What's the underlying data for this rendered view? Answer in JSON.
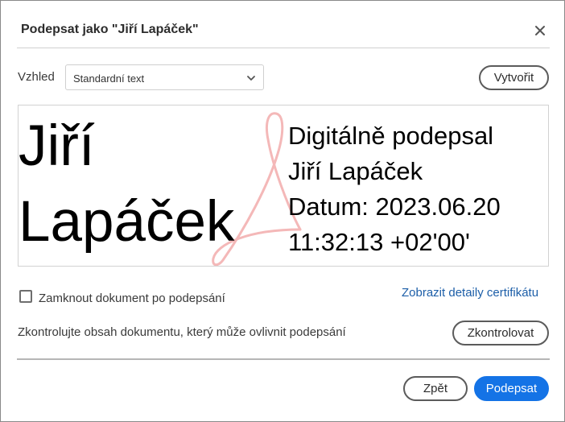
{
  "dialog": {
    "title": "Podepsat jako \"Jiří Lapáček\"",
    "close_icon": "close-icon"
  },
  "appearance": {
    "label": "Vzhled",
    "selected": "Standardní text",
    "create_label": "Vytvořit"
  },
  "preview": {
    "name": "Jiří\nLapáček",
    "details_lines": [
      "Digitálně podepsal",
      "Jiří Lapáček",
      "Datum: 2023.06.20",
      "11:32:13 +02'00'"
    ],
    "watermark_icon": "acrobat-logo-watermark"
  },
  "options": {
    "lock_label": "Zamknout dokument po podepsání",
    "lock_checked": false,
    "cert_link": "Zobrazit detaily certifikátu",
    "check_text": "Zkontrolujte obsah dokumentu, který může ovlivnit podepsání",
    "check_label": "Zkontrolovat"
  },
  "footer": {
    "back_label": "Zpět",
    "sign_label": "Podepsat"
  },
  "colors": {
    "primary": "#1473e6",
    "link": "#1c5ea8",
    "watermark": "#f4b8b8"
  }
}
